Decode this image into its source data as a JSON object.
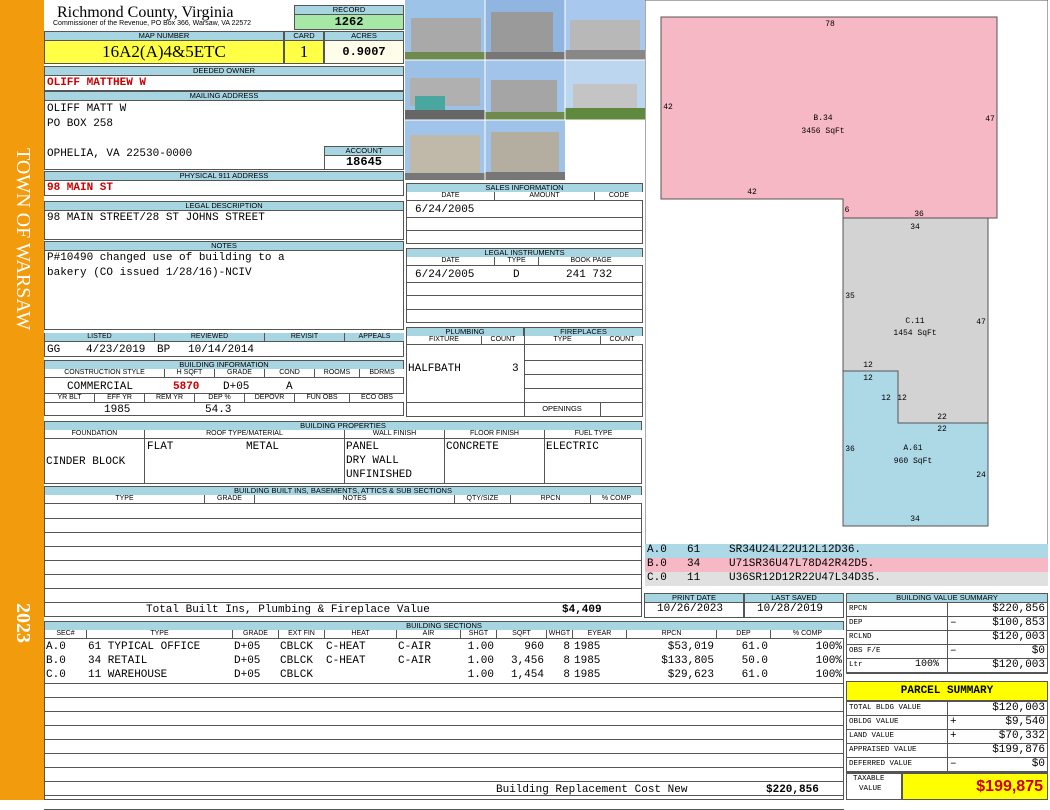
{
  "sidebar": {
    "town": "TOWN OF WARSAW",
    "year": "2023"
  },
  "header": {
    "county": "Richmond County, Virginia",
    "commissioner": "Commissioner of the Revenue, PO Box 366, Warsaw, VA 22572",
    "record_label": "RECORD",
    "record": "1262",
    "map_label": "MAP NUMBER",
    "map": "16A2(A)4&5ETC",
    "card_label": "CARD",
    "card": "1",
    "acres_label": "ACRES",
    "acres": "0.9007"
  },
  "owner": {
    "label": "DEEDED OWNER",
    "name": "OLIFF MATTHEW W",
    "mailing_label": "MAILING ADDRESS",
    "mail1": "OLIFF MATT W",
    "mail2": "PO BOX 258",
    "mail3": "OPHELIA, VA 22530-0000",
    "account_label": "ACCOUNT",
    "account": "18645"
  },
  "physical": {
    "label": "PHYSICAL 911 ADDRESS",
    "value": "98 MAIN ST"
  },
  "legal": {
    "label": "LEGAL DESCRIPTION",
    "value": "98 MAIN STREET/28 ST JOHNS STREET"
  },
  "notes": {
    "label": "NOTES",
    "line1": "P#10490 changed use of building to a",
    "line2": "bakery (CO issued 1/28/16)-NCIV"
  },
  "sales": {
    "label": "SALES INFORMATION",
    "h_date": "DATE",
    "h_amount": "AMOUNT",
    "h_code": "CODE",
    "date": "6/24/2005"
  },
  "instruments": {
    "label": "LEGAL INSTRUMENTS",
    "h_date": "DATE",
    "h_type": "TYPE",
    "h_book": "BOOK PAGE",
    "date": "6/24/2005",
    "type": "D",
    "book": "241 732"
  },
  "listing": {
    "h_listed": "LISTED",
    "h_reviewed": "REVIEWED",
    "h_revisit": "REVISIT",
    "h_appeals": "APPEALS",
    "l_by": "GG",
    "l_date": "4/23/2019",
    "r_by": "BP",
    "r_date": "10/14/2014"
  },
  "bldg_info": {
    "label": "BUILDING INFORMATION",
    "h_style": "CONSTRUCTION STYLE",
    "h_hsqft": "H SQFT",
    "h_grade": "GRADE",
    "h_cond": "COND",
    "h_rooms": "ROOMS",
    "h_bdrms": "BDRMS",
    "style": "COMMERCIAL",
    "hsqft": "5870",
    "grade": "D+05",
    "cond": "A",
    "h_yrblt": "YR BLT",
    "h_effyr": "EFF YR",
    "h_remyr": "REM YR",
    "h_dep": "DEP %",
    "h_depovr": "DEPOVR",
    "h_funobs": "FUN OBS",
    "h_ecoobs": "ECO OBS",
    "effyr": "1985",
    "dep": "54.3"
  },
  "plumbing": {
    "label": "PLUMBING",
    "h_fixture": "FIXTURE",
    "h_count": "COUNT",
    "fixture": "HALFBATH",
    "count": "3"
  },
  "fireplaces": {
    "label": "FIREPLACES",
    "h_type": "TYPE",
    "h_count": "COUNT",
    "openings": "OPENINGS"
  },
  "props": {
    "label": "BUILDING PROPERTIES",
    "h_found": "FOUNDATION",
    "h_roof": "ROOF TYPE/MATERIAL",
    "h_wall": "WALL FINISH",
    "h_floor": "FLOOR FINISH",
    "h_fuel": "FUEL TYPE",
    "found": "CINDER BLOCK",
    "roof_type": "FLAT",
    "roof_mat": "METAL",
    "wall1": "PANEL",
    "wall2": "DRY WALL",
    "wall3": "UNFINISHED",
    "floor": "CONCRETE",
    "fuel": "ELECTRIC"
  },
  "builtins": {
    "label": "BUILDING BUILT INS, BASEMENTS, ATTICS & SUB SECTIONS",
    "h_type": "TYPE",
    "h_grade": "GRADE",
    "h_notes": "NOTES",
    "h_qty": "QTY/SIZE",
    "h_rpcn": "RPCN",
    "h_comp": "% COMP",
    "total_label": "Total Built Ins, Plumbing & Fireplace Value",
    "total": "$4,409"
  },
  "sections": {
    "label": "BUILDING SECTIONS",
    "headers": [
      "SEC#",
      "TYPE",
      "GRADE",
      "EXT FIN",
      "HEAT",
      "AIR",
      "SHGT",
      "SQFT",
      "WHGT",
      "EYEAR",
      "RPCN",
      "DEP",
      "% COMP"
    ],
    "rows": [
      {
        "sec": "A.0",
        "type": "61 TYPICAL OFFICE",
        "grade": "D+05",
        "ext": "CBLCK",
        "heat": "C-HEAT",
        "air": "C-AIR",
        "shgt": "1.00",
        "sqft": "960",
        "whgt": "8",
        "eyear": "1985",
        "rpcn": "$53,019",
        "dep": "61.0",
        "comp": "100%"
      },
      {
        "sec": "B.0",
        "type": "34 RETAIL",
        "grade": "D+05",
        "ext": "CBLCK",
        "heat": "C-HEAT",
        "air": "C-AIR",
        "shgt": "1.00",
        "sqft": "3,456",
        "whgt": "8",
        "eyear": "1985",
        "rpcn": "$133,805",
        "dep": "50.0",
        "comp": "100%"
      },
      {
        "sec": "C.0",
        "type": "11 WAREHOUSE",
        "grade": "D+05",
        "ext": "CBLCK",
        "heat": "",
        "air": "",
        "shgt": "1.00",
        "sqft": "1,454",
        "whgt": "8",
        "eyear": "1985",
        "rpcn": "$29,623",
        "dep": "61.0",
        "comp": "100%"
      }
    ],
    "replacement_label": "Building Replacement Cost New",
    "replacement": "$220,856"
  },
  "sketch": {
    "b_label": "B.34",
    "b_area": "3456 SqFt",
    "c_label": "C.11",
    "c_area": "1454 SqFt",
    "a_label": "A.61",
    "a_area": "960 SqFt",
    "dims": [
      "78",
      "42",
      "47",
      "42",
      "6",
      "36",
      "34",
      "35",
      "47",
      "12",
      "12",
      "12",
      "12",
      "22",
      "22",
      "36",
      "24",
      "34"
    ],
    "vectors": [
      {
        "sec": "A.0",
        "code": "61",
        "path": "SR34U24L22U12L12D36."
      },
      {
        "sec": "B.0",
        "code": "34",
        "path": "U71SR36U47L78D42R42D5."
      },
      {
        "sec": "C.0",
        "code": "11",
        "path": "U36SR12D12R22U47L34D35."
      }
    ],
    "colors": {
      "a": "#add8e6",
      "b": "#f5b8c4",
      "c": "#d3d3d3"
    }
  },
  "dates": {
    "print_label": "PRINT DATE",
    "print": "10/26/2023",
    "saved_label": "LAST SAVED",
    "saved": "10/28/2019"
  },
  "value_summary": {
    "label": "BUILDING VALUE SUMMARY",
    "rows": [
      {
        "k": "RPCN",
        "op": "",
        "v": "$220,856"
      },
      {
        "k": "DEP",
        "op": "–",
        "v": "$100,853"
      },
      {
        "k": "RCLND",
        "op": "",
        "v": "$120,003"
      },
      {
        "k": "OBS F/E",
        "op": "–",
        "v": "$0"
      },
      {
        "k": "Ltr",
        "pct": "100%",
        "op": "",
        "v": "$120,003"
      }
    ]
  },
  "parcel": {
    "label": "PARCEL SUMMARY",
    "rows": [
      {
        "k": "TOTAL BLDG VALUE",
        "op": "",
        "v": "$120,003"
      },
      {
        "k": "OBLDG VALUE",
        "op": "+",
        "v": "$9,540"
      },
      {
        "k": "LAND VALUE",
        "op": "+",
        "v": "$70,332"
      },
      {
        "k": "APPRAISED VALUE",
        "op": "",
        "v": "$199,876"
      },
      {
        "k": "DEFERRED VALUE",
        "op": "–",
        "v": "$0"
      }
    ],
    "taxable_label1": "TAXABLE",
    "taxable_label2": "VALUE",
    "taxable": "$199,875"
  }
}
